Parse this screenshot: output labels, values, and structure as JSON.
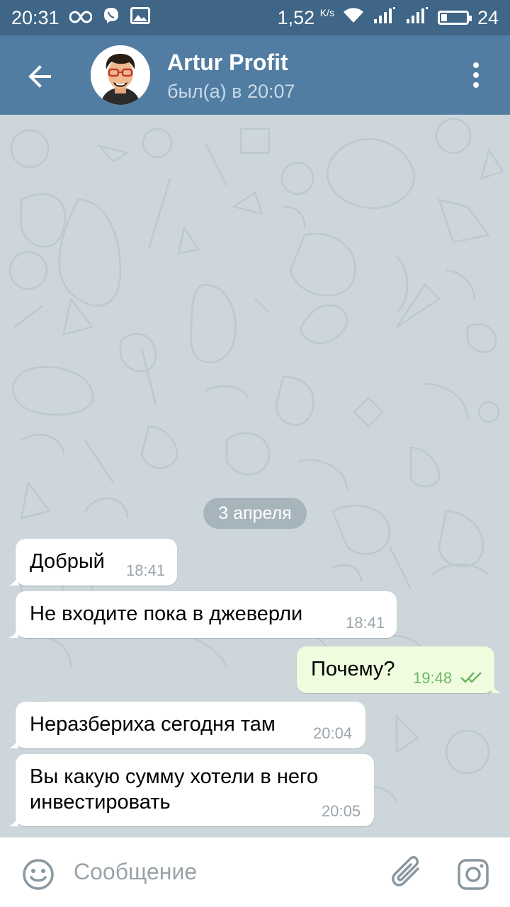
{
  "status_bar": {
    "time": "20:31",
    "net_speed": "1,52",
    "net_unit": "K/s",
    "battery": "24",
    "battery_level": 0.24,
    "icons": [
      "infinity-icon",
      "viber-icon",
      "image-icon",
      "wifi-icon",
      "signal-icon",
      "signal-icon",
      "battery-icon"
    ]
  },
  "header": {
    "contact_name": "Artur Profit",
    "last_seen": "был(а) в 20:07",
    "colors": {
      "bar": "#517da2",
      "status_bar": "#3f6587"
    }
  },
  "chat": {
    "date_separator": "3 апреля",
    "messages": [
      {
        "direction": "in",
        "text": "Добрый",
        "time": "18:41"
      },
      {
        "direction": "in",
        "text": "Не входите пока в джеверли",
        "time": "18:41"
      },
      {
        "direction": "out",
        "text": "Почему?",
        "time": "19:48",
        "read": true
      },
      {
        "direction": "in",
        "text": "Неразбериха сегодня там",
        "time": "20:04"
      },
      {
        "direction": "in",
        "text": "Вы какую сумму хотели в него инвестировать",
        "time": "20:05"
      }
    ],
    "colors": {
      "incoming": "#ffffff",
      "outgoing": "#effdde",
      "out_time": "#6db564"
    }
  },
  "composer": {
    "placeholder": "Сообщение",
    "icons": [
      "emoji-icon",
      "paperclip-icon",
      "camera-icon"
    ]
  }
}
